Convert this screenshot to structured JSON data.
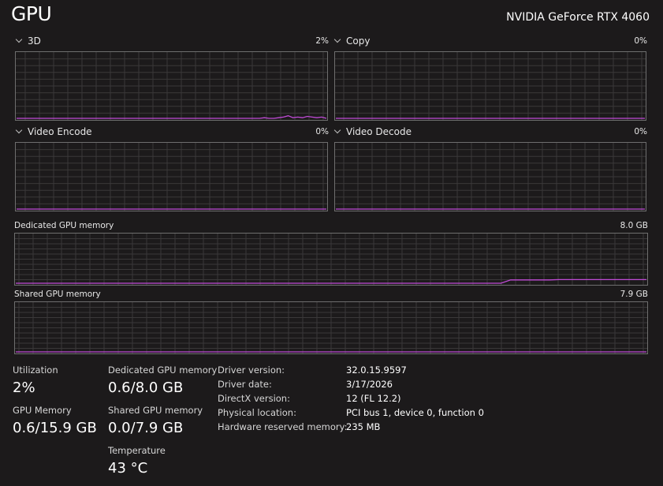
{
  "header": {
    "title": "GPU",
    "gpu_name": "NVIDIA GeForce RTX 4060"
  },
  "engines": [
    {
      "name": "3D",
      "value": "2%"
    },
    {
      "name": "Copy",
      "value": "0%"
    },
    {
      "name": "Video Encode",
      "value": "0%"
    },
    {
      "name": "Video Decode",
      "value": "0%"
    }
  ],
  "memory_graphs": {
    "dedicated": {
      "label": "Dedicated GPU memory",
      "max": "8.0 GB"
    },
    "shared": {
      "label": "Shared GPU memory",
      "max": "7.9 GB"
    }
  },
  "stats": {
    "utilization": {
      "label": "Utilization",
      "value": "2%"
    },
    "gpu_memory": {
      "label": "GPU Memory",
      "value": "0.6/15.9 GB"
    },
    "dedicated": {
      "label": "Dedicated GPU memory",
      "value": "0.6/8.0 GB"
    },
    "shared": {
      "label": "Shared GPU memory",
      "value": "0.0/7.9 GB"
    },
    "temperature": {
      "label": "Temperature",
      "value": "43 °C"
    }
  },
  "info": [
    {
      "label": "Driver version:",
      "value": "32.0.15.9597"
    },
    {
      "label": "Driver date:",
      "value": "3/17/2026"
    },
    {
      "label": "DirectX version:",
      "value": "12 (FL 12.2)"
    },
    {
      "label": "Physical location:",
      "value": "PCI bus 1, device 0, function 0"
    },
    {
      "label": "Hardware reserved memory:",
      "value": "235 MB"
    }
  ],
  "chart_data": [
    {
      "type": "area",
      "series": [
        {
          "values": [
            0,
            0,
            0,
            0,
            0,
            0,
            0,
            0,
            0,
            0,
            0,
            0,
            0,
            0,
            0,
            0,
            0,
            0,
            0,
            0,
            0,
            0,
            0,
            0,
            0,
            0,
            0,
            0,
            0,
            0,
            0,
            0,
            0,
            0,
            0,
            0,
            0,
            0,
            0,
            0,
            0,
            0,
            0,
            0,
            0,
            0,
            0,
            0,
            0,
            0,
            0,
            0,
            1,
            0,
            0,
            1,
            2,
            4,
            1,
            2,
            1,
            3,
            2,
            1,
            2,
            0
          ]
        }
      ],
      "ylim": [
        0,
        100
      ]
    },
    {
      "type": "area",
      "series": [
        {
          "values": [
            0,
            0,
            0,
            0,
            0,
            0,
            0,
            0,
            0,
            0
          ]
        }
      ],
      "ylim": [
        0,
        100
      ]
    },
    {
      "type": "area",
      "series": [
        {
          "values": [
            0,
            0,
            0,
            0,
            0,
            0,
            0,
            0,
            0,
            0
          ]
        }
      ],
      "ylim": [
        0,
        100
      ]
    },
    {
      "type": "area",
      "series": [
        {
          "values": [
            0,
            0,
            0,
            0,
            0,
            0,
            0,
            0,
            0,
            0
          ]
        }
      ],
      "ylim": [
        0,
        100
      ]
    },
    {
      "type": "area",
      "series": [
        {
          "values": [
            0,
            0,
            0,
            0,
            0,
            0,
            0,
            0,
            0,
            0,
            0,
            0,
            0,
            0,
            0,
            0,
            0,
            0,
            0,
            0,
            0,
            0,
            0,
            0,
            0,
            0,
            0,
            0,
            0,
            0,
            0,
            0,
            0,
            0,
            0,
            0,
            0,
            0,
            0,
            0,
            0,
            0,
            0,
            0,
            0,
            0,
            0,
            0,
            0,
            0,
            0,
            0.55,
            0.55,
            0.55,
            0.55,
            0.55,
            0.6,
            0.6,
            0.6,
            0.6,
            0.6,
            0.6,
            0.6,
            0.6,
            0.6,
            0.6
          ]
        }
      ],
      "ylim": [
        0,
        8.0
      ]
    },
    {
      "type": "area",
      "series": [
        {
          "values": [
            0,
            0,
            0,
            0,
            0,
            0,
            0,
            0,
            0,
            0
          ]
        }
      ],
      "ylim": [
        0,
        7.9
      ]
    }
  ]
}
